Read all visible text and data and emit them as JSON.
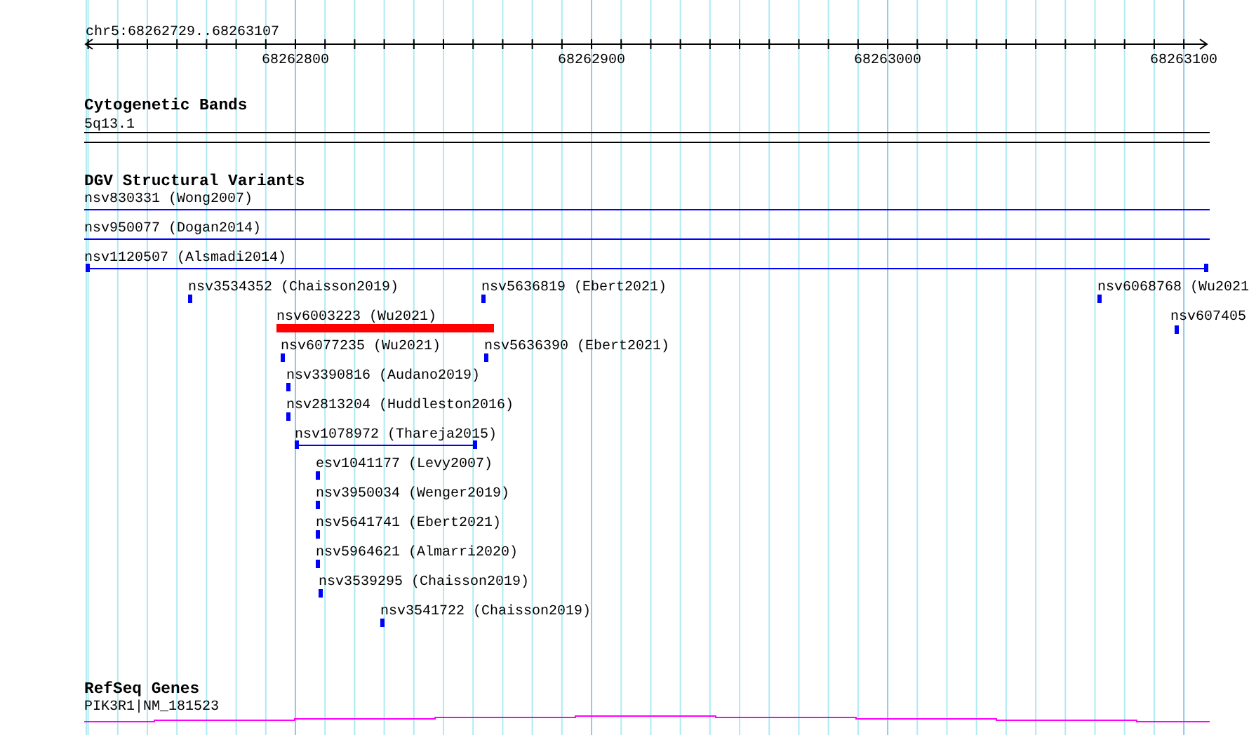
{
  "ruler": {
    "region": "chr5:68262729..68263107",
    "tick_labels": [
      "68262800",
      "68262900",
      "68263000",
      "68263100"
    ]
  },
  "tracks": [
    {
      "title": "Cytogenetic Bands",
      "kind": "bands",
      "features": [
        {
          "label": "5q13.1"
        }
      ]
    },
    {
      "title": "DGV Structural Variants",
      "kind": "variants",
      "features": [
        {
          "label": "nsv830331 (Wong2007)",
          "kind": "line",
          "color": "#0000ff"
        },
        {
          "label": "nsv950077 (Dogan2014)",
          "kind": "line",
          "color": "#0000ff"
        },
        {
          "label": "nsv1120507 (Alsmadi2014)",
          "kind": "capped",
          "color": "#0000ff"
        },
        {
          "label": "nsv3534352 (Chaisson2019)",
          "kind": "block",
          "color": "#0000ff"
        },
        {
          "label": "nsv5636819 (Ebert2021)",
          "kind": "block",
          "color": "#0000ff"
        },
        {
          "label": "nsv6068768 (Wu2021",
          "kind": "block",
          "color": "#0000ff"
        },
        {
          "label": "nsv6003223 (Wu2021)",
          "kind": "block",
          "color": "#ff0000"
        },
        {
          "label": "nsv607405",
          "kind": "block",
          "color": "#0000ff"
        },
        {
          "label": "nsv6077235 (Wu2021)",
          "kind": "block",
          "color": "#0000ff"
        },
        {
          "label": "nsv5636390 (Ebert2021)",
          "kind": "block",
          "color": "#0000ff"
        },
        {
          "label": "nsv3390816 (Audano2019)",
          "kind": "block",
          "color": "#0000ff"
        },
        {
          "label": "nsv2813204 (Huddleston2016)",
          "kind": "block",
          "color": "#0000ff"
        },
        {
          "label": "nsv1078972 (Thareja2015)",
          "kind": "capped",
          "color": "#0000ff"
        },
        {
          "label": "esv1041177 (Levy2007)",
          "kind": "block",
          "color": "#0000ff"
        },
        {
          "label": "nsv3950034 (Wenger2019)",
          "kind": "block",
          "color": "#0000ff"
        },
        {
          "label": "nsv5641741 (Ebert2021)",
          "kind": "block",
          "color": "#0000ff"
        },
        {
          "label": "nsv5964621 (Almarri2020)",
          "kind": "block",
          "color": "#0000ff"
        },
        {
          "label": "nsv3539295 (Chaisson2019)",
          "kind": "block",
          "color": "#0000ff"
        },
        {
          "label": "nsv3541722 (Chaisson2019)",
          "kind": "block",
          "color": "#0000ff"
        }
      ]
    },
    {
      "title": "RefSeq Genes",
      "kind": "gene",
      "features": [
        {
          "label": "PIK3R1|NM_181523"
        }
      ]
    }
  ]
}
